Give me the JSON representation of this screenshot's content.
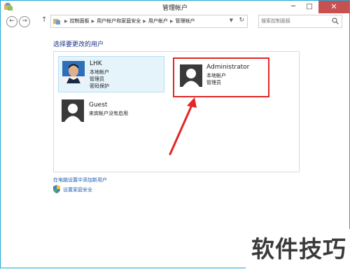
{
  "window": {
    "title": "管理帐户",
    "controls": {
      "minimize": "─",
      "maximize": "□",
      "close": "✕"
    }
  },
  "nav": {
    "back": "←",
    "forward": "→",
    "up": "↑",
    "breadcrumbs": [
      "控制面板",
      "用户帐户和家庭安全",
      "用户帐户",
      "管理帐户"
    ],
    "search_placeholder": "搜索控制面板"
  },
  "content": {
    "heading": "选择要更改的用户",
    "users": [
      {
        "name": "LHK",
        "lines": [
          "本地帐户",
          "管理员",
          "密码保护"
        ],
        "selected": true
      },
      {
        "name": "Administrator",
        "lines": [
          "本地帐户",
          "管理员"
        ],
        "highlighted": true
      },
      {
        "name": "Guest",
        "lines": [
          "来宾帐户没有启用"
        ]
      }
    ],
    "links": {
      "add_user": "在电脑设置中添加新用户",
      "family_safety": "设置家庭安全"
    }
  },
  "watermark": "软件技巧",
  "colors": {
    "accent_border": "#21a7d6",
    "highlight_box": "#e32626",
    "link": "#1f5fb5",
    "heading": "#1e3287"
  }
}
